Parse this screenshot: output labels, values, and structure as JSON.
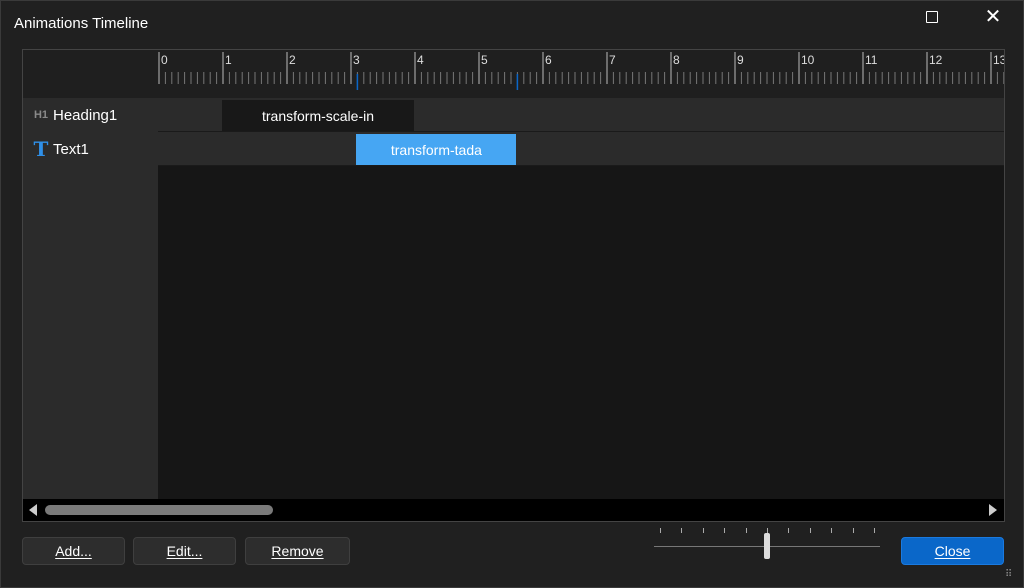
{
  "window": {
    "title": "Animations Timeline"
  },
  "titlebar": {
    "maximize_icon": "maximize-icon",
    "close_icon": "close-icon",
    "close_glyph": "✕"
  },
  "ruler": {
    "labels": [
      "0",
      "1",
      "2",
      "3",
      "4",
      "5",
      "6",
      "7",
      "8",
      "9",
      "10",
      "11",
      "12",
      "13"
    ]
  },
  "layers": [
    {
      "icon": "heading-icon",
      "icon_text": "H1",
      "name": "Heading1"
    },
    {
      "icon": "text-icon",
      "icon_text": "T",
      "name": "Text1"
    }
  ],
  "clips": [
    {
      "label": "transform-scale-in",
      "start": 1,
      "duration": 3,
      "color": "#181818"
    },
    {
      "label": "transform-tada",
      "start": 3.1,
      "duration": 2.5,
      "color": "#46a6f3"
    }
  ],
  "buttons": {
    "add": "Add...",
    "edit": "Edit...",
    "remove": "Remove",
    "close": "Close"
  },
  "zoom_slider": {
    "value": 0.5,
    "ticks": 11
  },
  "colors": {
    "accent": "#0a67c9",
    "clip_highlight": "#46a6f3",
    "icon_blue": "#2f90e8"
  }
}
